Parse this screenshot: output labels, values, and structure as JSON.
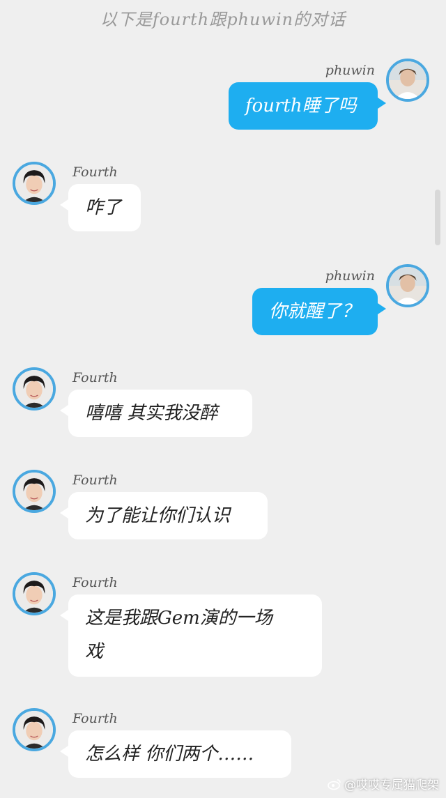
{
  "header": {
    "title": "以下是fourth跟phuwin的对话"
  },
  "colors": {
    "accent": "#1eaef0",
    "avatar_ring": "#4aa8e0",
    "background": "#efefef"
  },
  "messages": [
    {
      "sender": "phuwin",
      "side": "right",
      "text": "fourth睡了吗"
    },
    {
      "sender": "Fourth",
      "side": "left",
      "text": "咋了"
    },
    {
      "sender": "phuwin",
      "side": "right",
      "text": "你就醒了？"
    },
    {
      "sender": "Fourth",
      "side": "left",
      "text": "嘻嘻 其实我没醉"
    },
    {
      "sender": "Fourth",
      "side": "left",
      "text": "为了能让你们认识"
    },
    {
      "sender": "Fourth",
      "side": "left",
      "text": "这是我跟Gem演的一场戏"
    },
    {
      "sender": "Fourth",
      "side": "left",
      "text": "怎么样 你们两个……"
    }
  ],
  "watermark": {
    "text": "@哎哎专属猫爬架",
    "icon": "weibo-icon"
  }
}
